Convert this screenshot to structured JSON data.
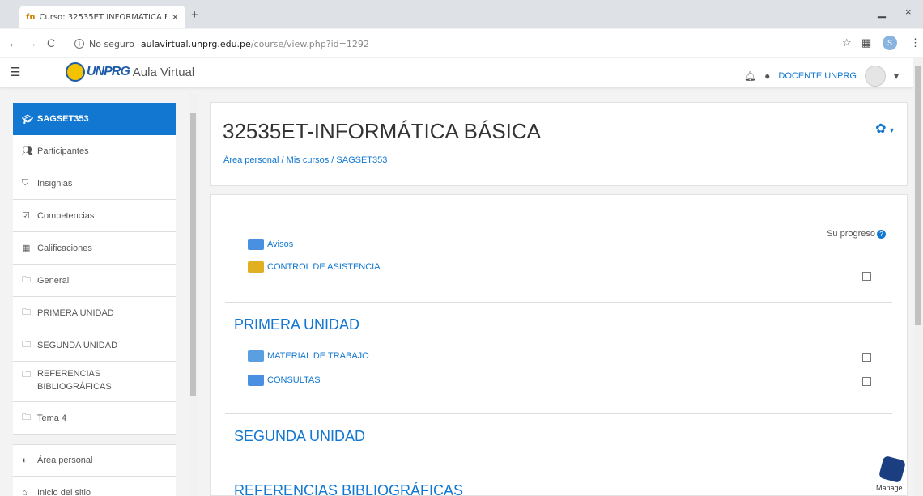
{
  "browser": {
    "tab_favicon": "fn",
    "tab_title": "Curso: 32535ET INFORMÁTICA B",
    "new_tab": "+",
    "minimize": "1",
    "close": "×",
    "back": "←",
    "forward": "→",
    "reload": "C",
    "security_text": "No seguro",
    "url_host": "aulavirtual.unprg.edu.pe",
    "url_path": "/course/view.php?id=1292",
    "profile_initial": "S"
  },
  "navbar": {
    "brand": "UNPRG",
    "site_name": "Aula Virtual",
    "user_name": "DOCENTE UNPRG"
  },
  "drawer": {
    "items": [
      {
        "label": "SAGSET353",
        "icon": "graduation-cap-icon"
      },
      {
        "label": "Participantes",
        "icon": "users-icon"
      },
      {
        "label": "Insignias",
        "icon": "shield-icon"
      },
      {
        "label": "Competencias",
        "icon": "check-square-icon"
      },
      {
        "label": "Calificaciones",
        "icon": "table-icon"
      },
      {
        "label": "General",
        "icon": "folder-icon"
      },
      {
        "label": "PRIMERA UNIDAD",
        "icon": "folder-icon"
      },
      {
        "label": "SEGUNDA UNIDAD",
        "icon": "folder-icon"
      },
      {
        "label": "REFERENCIAS BIBLIOGRÁFICAS",
        "icon": "folder-icon"
      },
      {
        "label": "Tema 4",
        "icon": "folder-icon"
      },
      {
        "label": "Área personal",
        "icon": "tachometer-icon"
      },
      {
        "label": "Inicio del sitio",
        "icon": "home-icon"
      }
    ]
  },
  "page": {
    "title": "32535ET-INFORMÁTICA BÁSICA",
    "breadcrumb": [
      "Área personal",
      "Mis cursos",
      "SAGSET353"
    ],
    "progress_label": "Su progreso"
  },
  "sections": {
    "general": {
      "activities": [
        "Avisos",
        "CONTROL DE ASISTENCIA"
      ]
    },
    "primera": {
      "title": "PRIMERA UNIDAD",
      "activities": [
        "MATERIAL DE TRABAJO",
        "CONSULTAS"
      ]
    },
    "segunda": {
      "title": "SEGUNDA UNIDAD"
    },
    "referencias": {
      "title": "REFERENCIAS BIBLIOGRÁFICAS"
    }
  },
  "manage": {
    "label": "Manage"
  },
  "colors": {
    "accent": "#1177d1",
    "logo_blue": "#1e5ca8",
    "logo_yellow": "#f3c300"
  }
}
